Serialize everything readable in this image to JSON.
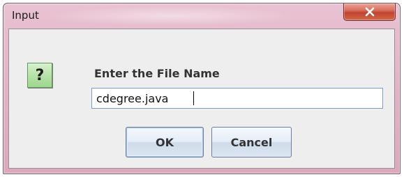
{
  "window": {
    "title": "Input",
    "close_glyph": "x"
  },
  "dialog": {
    "icon": "question-icon",
    "icon_glyph": "?",
    "prompt": "Enter the File Name",
    "input_value": "cdegree.java"
  },
  "buttons": {
    "ok_label": "OK",
    "cancel_label": "Cancel"
  },
  "colors": {
    "titlebar": "#e2b4c6",
    "close_button": "#c2432f",
    "client_bg": "#eeeeee",
    "icon_green": "#b7e2a8",
    "field_border": "#7a9cc7"
  }
}
